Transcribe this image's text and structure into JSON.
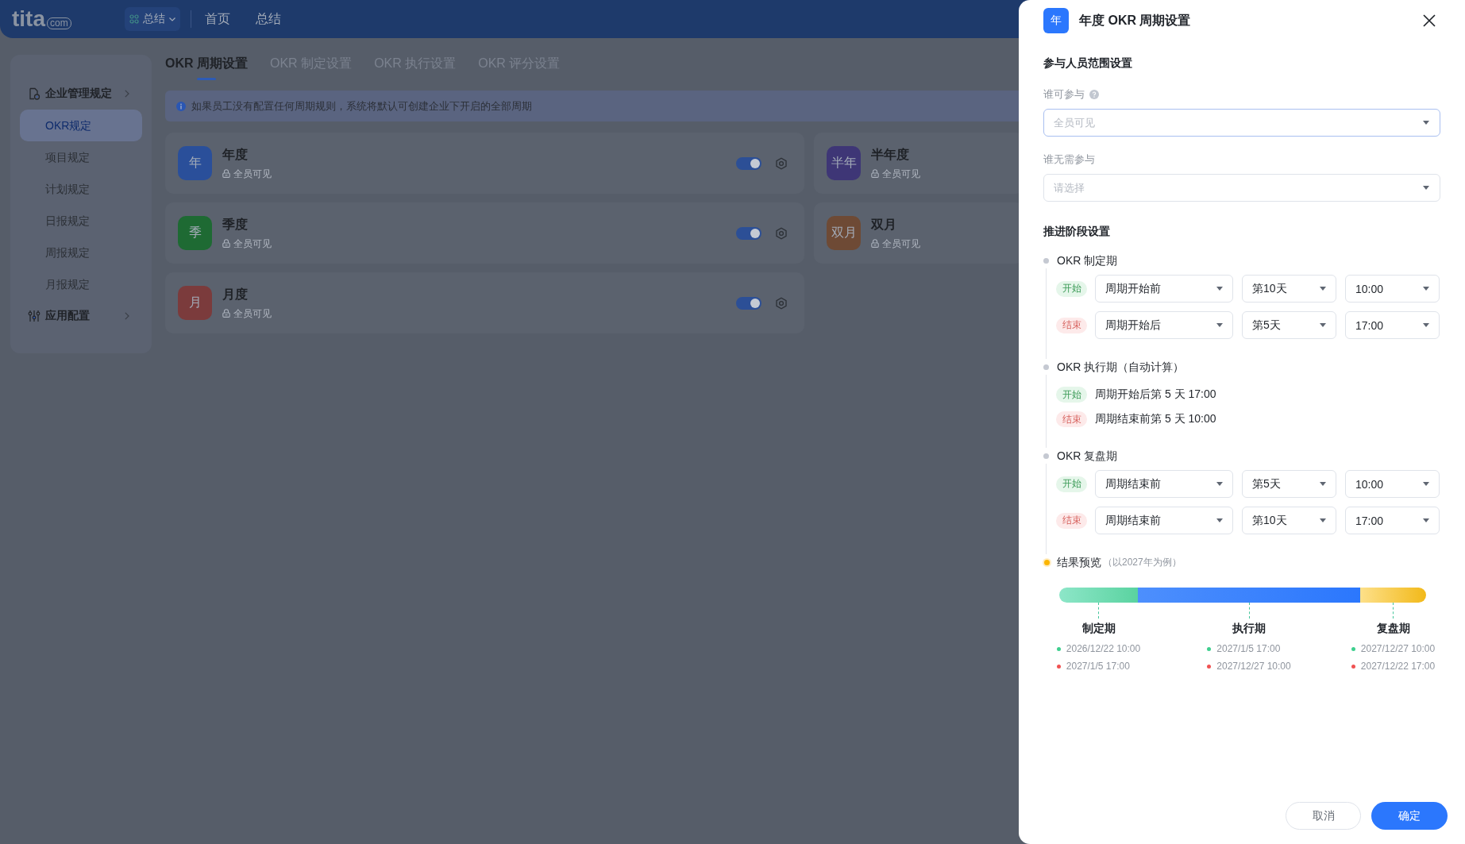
{
  "header": {
    "logo": {
      "wordmark": "tita",
      "suffix": "com"
    },
    "app_switcher": {
      "label": "总结"
    },
    "nav": [
      {
        "label": "首页",
        "selected": false
      },
      {
        "label": "总结",
        "selected": false
      }
    ]
  },
  "sidebar": {
    "sections": [
      {
        "title": "企业管理规定",
        "items": [
          {
            "label": "OKR规定",
            "selected": true
          },
          {
            "label": "项目规定",
            "selected": false
          },
          {
            "label": "计划规定",
            "selected": false
          },
          {
            "label": "日报规定",
            "selected": false
          },
          {
            "label": "周报规定",
            "selected": false
          },
          {
            "label": "月报规定",
            "selected": false
          }
        ]
      },
      {
        "title": "应用配置"
      }
    ]
  },
  "tabs": [
    {
      "label": "OKR 周期设置",
      "selected": true
    },
    {
      "label": "OKR 制定设置",
      "selected": false
    },
    {
      "label": "OKR 执行设置",
      "selected": false
    },
    {
      "label": "OKR 评分设置",
      "selected": false
    }
  ],
  "notice": {
    "text": "如果员工没有配置任何周期规则，系统将默认可创建企业下开启的全部周期"
  },
  "cycles": [
    {
      "badge": "年",
      "title": "年度",
      "visibility": "全员可见",
      "color": "#2a4f9a",
      "enabled": true
    },
    {
      "badge": "半年",
      "title": "半年度",
      "visibility": "全员可见",
      "color": "#3e3676"
    },
    {
      "badge": "季",
      "title": "季度",
      "visibility": "全员可见",
      "color": "#1e6a33",
      "enabled": true
    },
    {
      "badge": "双月",
      "title": "双月",
      "visibility": "全员可见",
      "color": "#6e4a35"
    },
    {
      "badge": "月",
      "title": "月度",
      "visibility": "全员可见",
      "color": "#7b3b3c",
      "enabled": true
    }
  ],
  "drawer": {
    "badge": "年",
    "title": "年度 OKR 周期设置",
    "participants": {
      "heading": "参与人员范围设置",
      "fields": [
        {
          "label": "谁可参与",
          "help": true,
          "placeholder": "全员可见",
          "focused": true
        },
        {
          "label": "谁无需参与",
          "help": false,
          "placeholder": "请选择",
          "focused": false
        }
      ]
    },
    "stages": {
      "heading": "推进阶段设置",
      "items": [
        {
          "title": "OKR 制定期",
          "rows": [
            {
              "kind": "start",
              "tag": "开始",
              "selects": [
                "周期开始前",
                "第10天",
                "10:00"
              ]
            },
            {
              "kind": "end",
              "tag": "结束",
              "selects": [
                "周期开始后",
                "第5天",
                "17:00"
              ]
            }
          ]
        },
        {
          "title": "OKR 执行期（自动计算）",
          "rows": [
            {
              "kind": "start",
              "tag": "开始",
              "text": "周期开始后第 5 天 17:00"
            },
            {
              "kind": "end",
              "tag": "结束",
              "text": "周期结束前第 5 天 10:00"
            }
          ]
        },
        {
          "title": "OKR 复盘期",
          "rows": [
            {
              "kind": "start",
              "tag": "开始",
              "selects": [
                "周期结束前",
                "第5天",
                "10:00"
              ]
            },
            {
              "kind": "end",
              "tag": "结束",
              "selects": [
                "周期结束前",
                "第10天",
                "17:00"
              ]
            }
          ]
        }
      ]
    },
    "preview": {
      "title": "结果预览",
      "note": "（以2027年为例）",
      "phases": [
        {
          "kind": "draft",
          "label": "制定期",
          "start": "2026/12/22 10:00",
          "end": "2027/1/5 17:00"
        },
        {
          "kind": "execute",
          "label": "执行期",
          "start": "2027/1/5 17:00",
          "end": "2027/12/27 10:00"
        },
        {
          "kind": "review",
          "label": "复盘期",
          "start": "2027/12/27 10:00",
          "end": "2027/12/22 17:00"
        }
      ]
    },
    "buttons": [
      {
        "kind": "secondary",
        "label": "取消"
      },
      {
        "kind": "primary",
        "label": "确定"
      }
    ]
  }
}
